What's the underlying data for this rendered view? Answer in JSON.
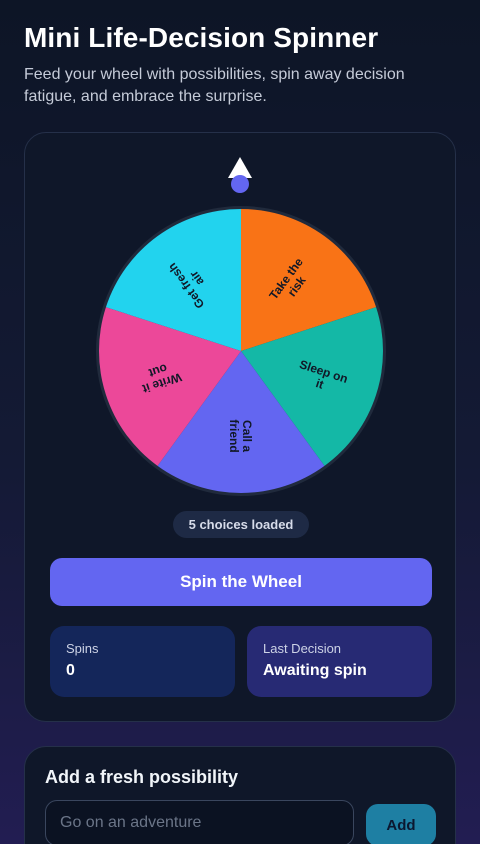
{
  "header": {
    "title": "Mini Life-Decision Spinner",
    "subtitle": "Feed your wheel with possibilities, spin away decision fatigue, and embrace the surprise."
  },
  "pointer": {
    "icon": "pointer-arrow-icon",
    "color": "#ffffff",
    "dot_color": "#6366f1"
  },
  "wheel": {
    "segments": [
      {
        "label_lines": [
          "Take the",
          "risk"
        ],
        "color": "#f97316"
      },
      {
        "label_lines": [
          "Sleep on",
          "it"
        ],
        "color": "#14b8a6"
      },
      {
        "label_lines": [
          "Call a",
          "friend"
        ],
        "color": "#6366f1"
      },
      {
        "label_lines": [
          "Write it",
          "out"
        ],
        "color": "#ec4899"
      },
      {
        "label_lines": [
          "Get fresh",
          "air"
        ],
        "color": "#22d3ee"
      }
    ]
  },
  "badge": {
    "text": "5 choices loaded"
  },
  "spin_button": {
    "label": "Spin the Wheel"
  },
  "stats": {
    "spins_label": "Spins",
    "spins_value": "0",
    "last_label": "Last Decision",
    "last_value": "Awaiting spin"
  },
  "add_form": {
    "title": "Add a fresh possibility",
    "placeholder": "Go on an adventure",
    "value": "",
    "button_label": "Add"
  }
}
